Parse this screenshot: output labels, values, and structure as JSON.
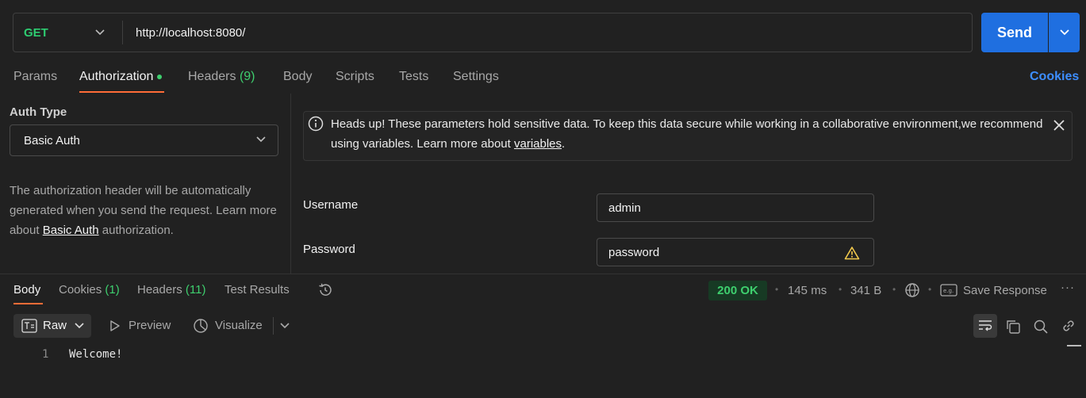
{
  "request": {
    "method": "GET",
    "url": "http://localhost:8080/",
    "send_label": "Send"
  },
  "tabs": [
    {
      "label": "Params"
    },
    {
      "label": "Authorization"
    },
    {
      "label": "Headers",
      "count": "(9)"
    },
    {
      "label": "Body"
    },
    {
      "label": "Scripts"
    },
    {
      "label": "Tests"
    },
    {
      "label": "Settings"
    }
  ],
  "cookies_label": "Cookies",
  "auth": {
    "type_label": "Auth Type",
    "type_value": "Basic Auth",
    "desc_prefix": "The authorization header will be automatically generated when you send the request. Learn more about ",
    "desc_link": "Basic Auth",
    "desc_suffix": " authorization."
  },
  "banner": {
    "text": "Heads up! These parameters hold sensitive data. To keep this data secure while working in a collaborative environment,we recommend using variables. Learn more about ",
    "link": "variables",
    "suffix": "."
  },
  "fields": {
    "username_label": "Username",
    "username_value": "admin",
    "password_label": "Password",
    "password_value": "password"
  },
  "response": {
    "tabs": [
      {
        "label": "Body"
      },
      {
        "label": "Cookies",
        "count": "(1)"
      },
      {
        "label": "Headers",
        "count": "(11)"
      },
      {
        "label": "Test Results"
      }
    ],
    "status": "200 OK",
    "time": "145 ms",
    "size": "341 B",
    "save_label": "Save Response",
    "format": "Raw",
    "preview_label": "Preview",
    "visualize_label": "Visualize",
    "lines": [
      {
        "num": "1",
        "text": "Welcome!"
      }
    ]
  },
  "colors": {
    "accent": "#ff6c37",
    "send": "#1f6fe0",
    "success": "#3ecf6e",
    "link": "#3d8eff"
  }
}
